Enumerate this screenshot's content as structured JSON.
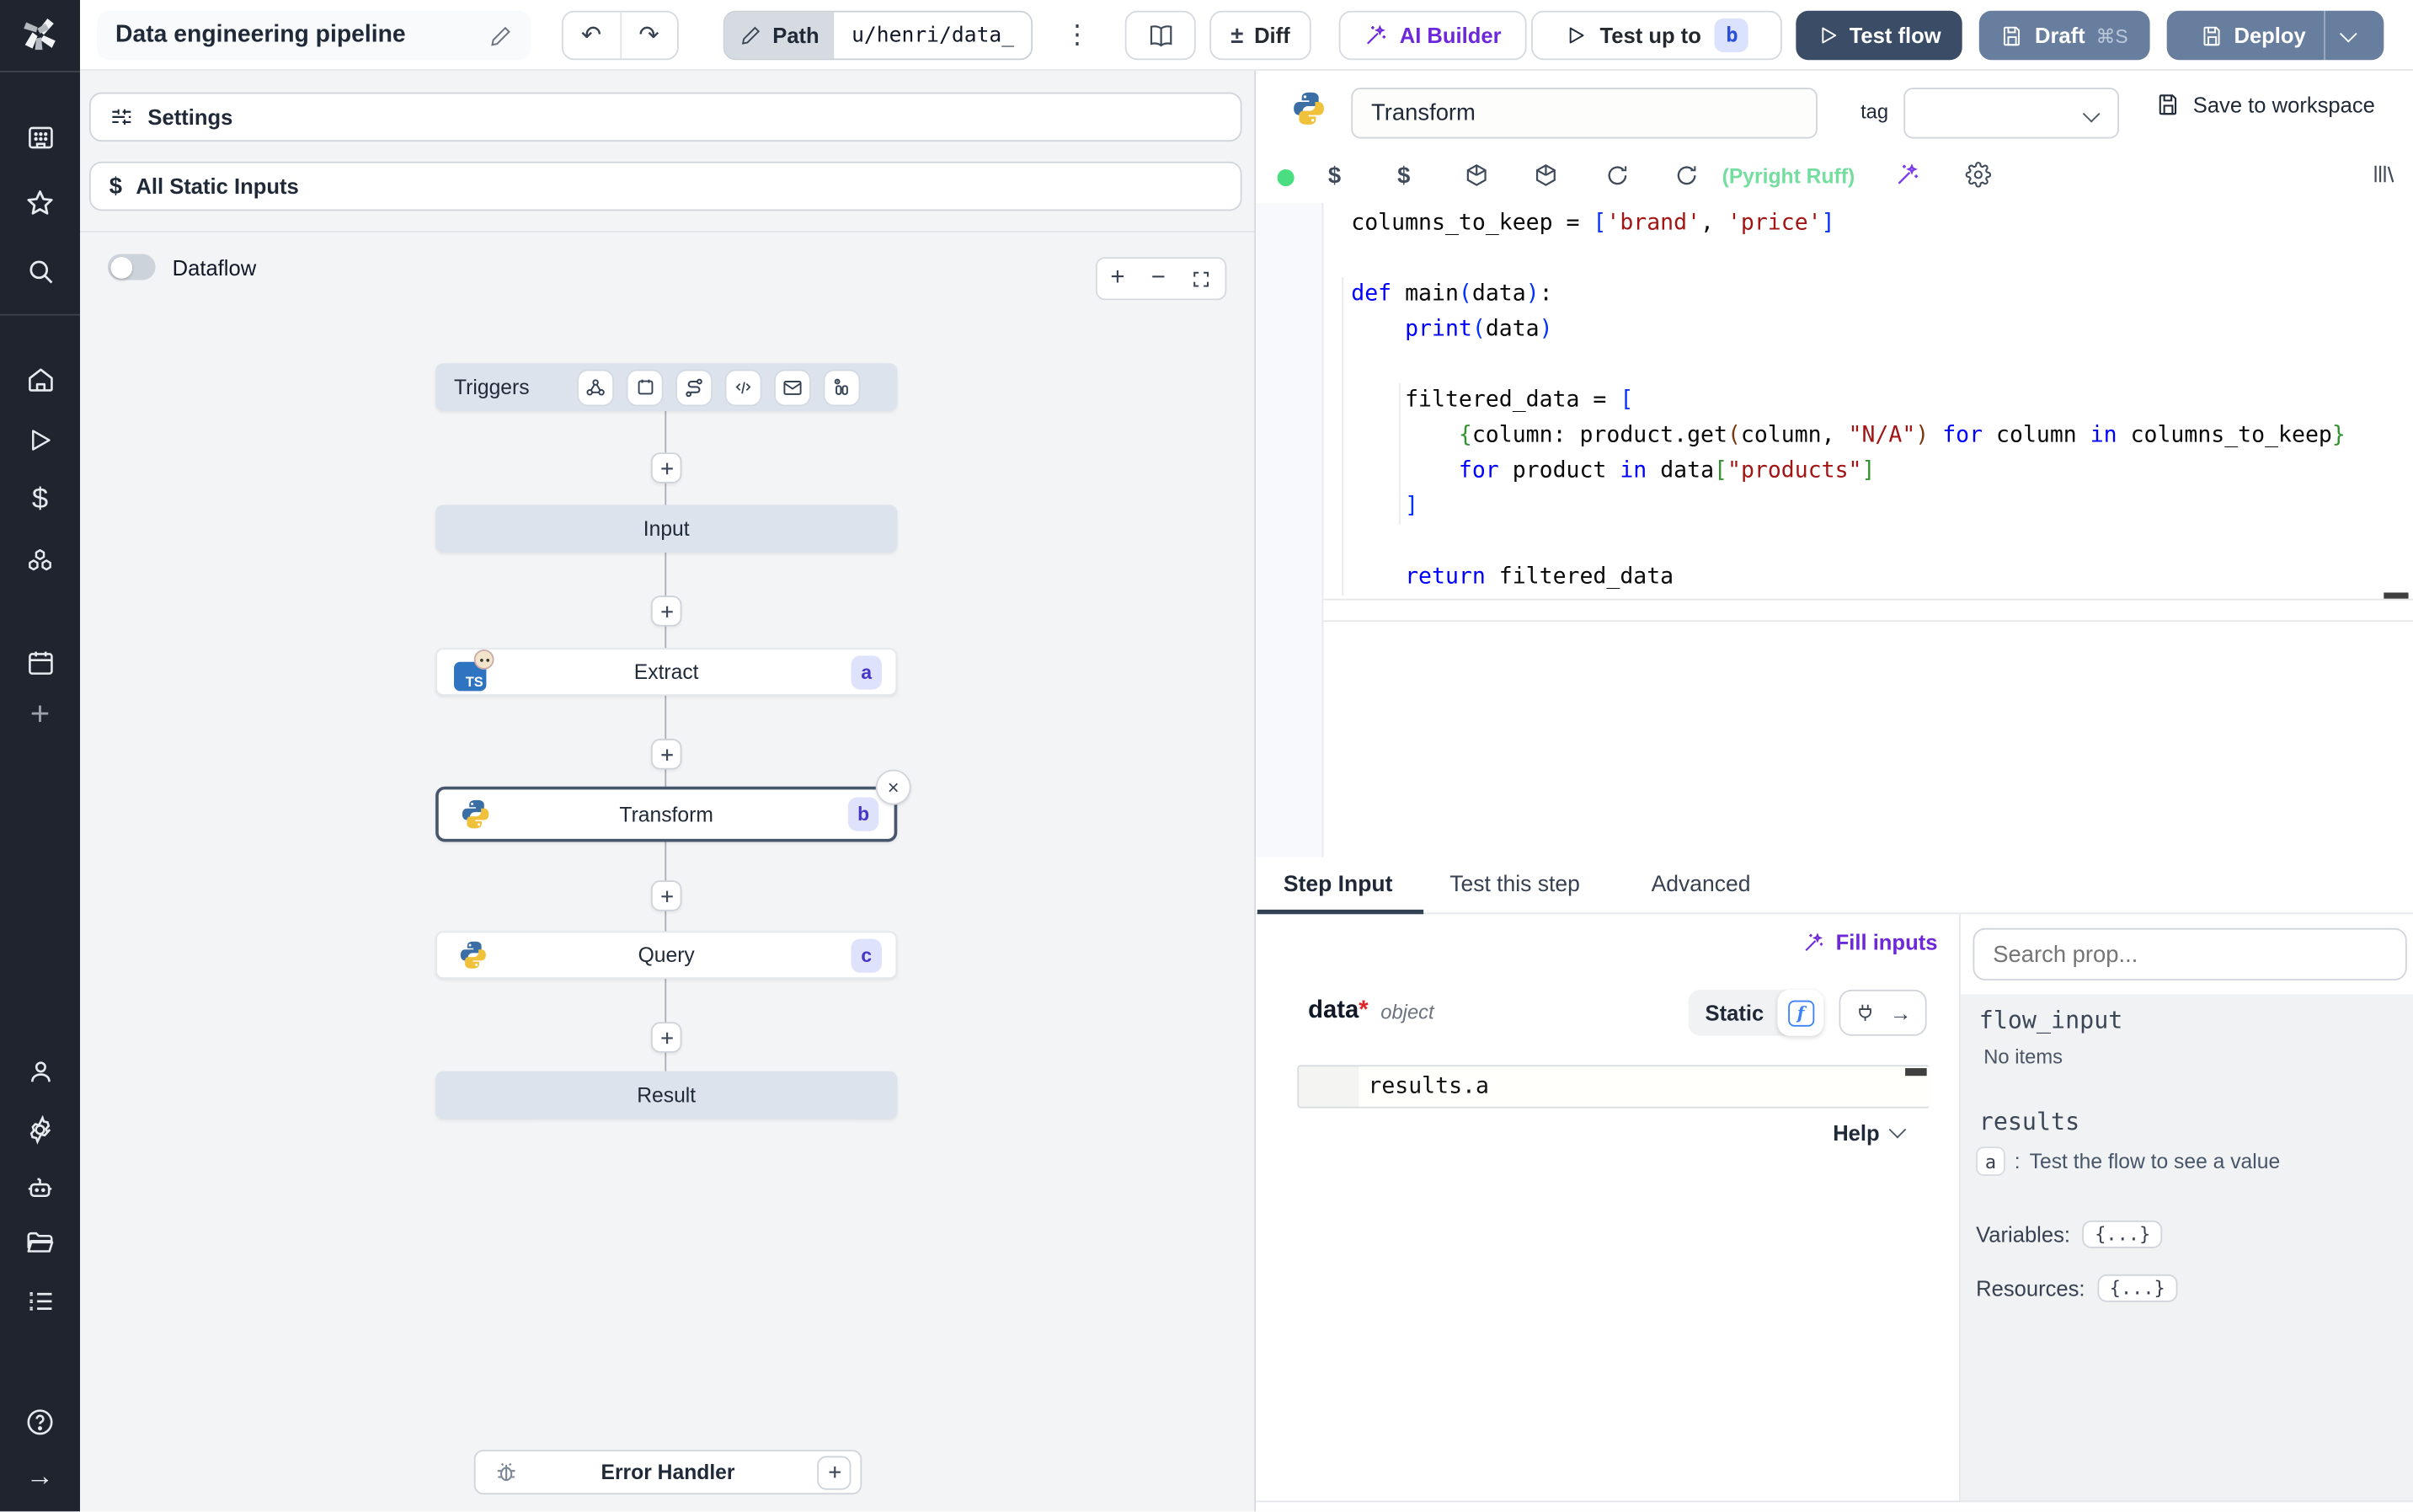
{
  "header": {
    "title": "Data engineering pipeline",
    "path_label": "Path",
    "path_value": "u/henri/data_",
    "diff_label": "Diff",
    "ai_builder_label": "AI Builder",
    "test_up_to_label": "Test up to",
    "test_up_to_badge": "b",
    "test_flow_label": "Test flow",
    "draft_label": "Draft",
    "draft_shortcut": "⌘S",
    "deploy_label": "Deploy"
  },
  "flow_panel": {
    "settings_label": "Settings",
    "all_static_inputs_label": "All Static Inputs",
    "dataflow_label": "Dataflow",
    "triggers_label": "Triggers",
    "nodes": {
      "input": {
        "label": "Input"
      },
      "extract": {
        "label": "Extract",
        "badge": "a",
        "icon_text": "TS"
      },
      "transform": {
        "label": "Transform",
        "badge": "b"
      },
      "query": {
        "label": "Query",
        "badge": "c"
      },
      "result": {
        "label": "Result"
      }
    },
    "error_handler_label": "Error Handler"
  },
  "editor": {
    "step_name": "Transform",
    "tag_label": "tag",
    "save_label": "Save to workspace",
    "lint_status": "(Pyright Ruff)",
    "tabs": [
      "Step Input",
      "Test this step",
      "Advanced"
    ],
    "code": {
      "language": "python",
      "lines": [
        [
          [
            "p",
            "columns_to_keep = "
          ],
          [
            "b1",
            "["
          ],
          [
            "s",
            "'brand'"
          ],
          [
            "p",
            ", "
          ],
          [
            "s",
            "'price'"
          ],
          [
            "b1",
            "]"
          ]
        ],
        [],
        [
          [
            "k",
            "def"
          ],
          [
            "p",
            " main"
          ],
          [
            "b1",
            "("
          ],
          [
            "p",
            "data"
          ],
          [
            "b1",
            ")"
          ],
          [
            "p",
            ":"
          ]
        ],
        [
          [
            "p",
            "    "
          ],
          [
            "k",
            "print"
          ],
          [
            "b1",
            "("
          ],
          [
            "p",
            "data"
          ],
          [
            "b1",
            ")"
          ]
        ],
        [],
        [
          [
            "p",
            "    filtered_data = "
          ],
          [
            "b1",
            "["
          ]
        ],
        [
          [
            "p",
            "        "
          ],
          [
            "b2",
            "{"
          ],
          [
            "p",
            "column: product.get"
          ],
          [
            "b3",
            "("
          ],
          [
            "p",
            "column, "
          ],
          [
            "s",
            "\"N/A\""
          ],
          [
            "b3",
            ")"
          ],
          [
            "p",
            " "
          ],
          [
            "k",
            "for"
          ],
          [
            "p",
            " column "
          ],
          [
            "k",
            "in"
          ],
          [
            "p",
            " columns_to_keep"
          ],
          [
            "b2",
            "}"
          ]
        ],
        [
          [
            "p",
            "        "
          ],
          [
            "k",
            "for"
          ],
          [
            "p",
            " product "
          ],
          [
            "k",
            "in"
          ],
          [
            "p",
            " data"
          ],
          [
            "b2",
            "["
          ],
          [
            "s",
            "\"products\""
          ],
          [
            "b2",
            "]"
          ]
        ],
        [
          [
            "p",
            "    "
          ],
          [
            "b1",
            "]"
          ]
        ],
        [],
        [
          [
            "p",
            "    "
          ],
          [
            "k",
            "return"
          ],
          [
            "p",
            " filtered_data"
          ]
        ]
      ]
    }
  },
  "step_input": {
    "fill_inputs_label": "Fill inputs",
    "field": {
      "name": "data",
      "required": "*",
      "type": "object"
    },
    "static_label": "Static",
    "fn_badge": "f",
    "expr_value": "results.a",
    "help_label": "Help"
  },
  "prop_panel": {
    "search_placeholder": "Search prop...",
    "flow_input_label": "flow_input",
    "no_items_label": "No items",
    "results_label": "results",
    "result_key": "a",
    "result_separator": ":",
    "result_hint": "Test the flow to see a value",
    "variables_label": "Variables:",
    "variables_value": "{...}",
    "resources_label": "Resources:",
    "resources_value": "{...}"
  },
  "colors": {
    "sidebar_bg": "#1f242e",
    "canvas_bg": "#f3f4f6",
    "node_light": "#dce3ec",
    "primary_dark_button": "#3a4c66",
    "secondary_button": "#687e9f",
    "accent_purple": "#6d28d9",
    "badge_bg": "#dee3fb",
    "badge_text": "#4734c8",
    "lint_green": "#74dd9f",
    "status_dot_green": "#4ade80"
  }
}
